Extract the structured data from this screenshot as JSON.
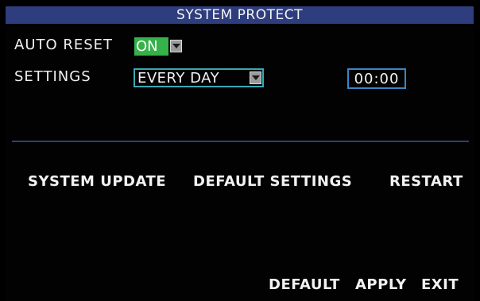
{
  "title": "SYSTEM PROTECT",
  "auto_reset": {
    "label": "AUTO RESET",
    "value": "ON",
    "value_color": "#35b24a"
  },
  "settings": {
    "label": "SETTINGS",
    "schedule": "EVERY DAY",
    "time": "00:00"
  },
  "actions": {
    "system_update": "SYSTEM UPDATE",
    "default_settings": "DEFAULT SETTINGS",
    "restart": "RESTART"
  },
  "footer": {
    "default": "DEFAULT",
    "apply": "APPLY",
    "exit": "EXIT"
  },
  "colors": {
    "title_bar": "#2e3d7e",
    "background": "#000000",
    "divider": "#2c3f78",
    "field_border": "#3aa8b3"
  },
  "icons": {
    "dropdown": "chevron-down-icon"
  }
}
